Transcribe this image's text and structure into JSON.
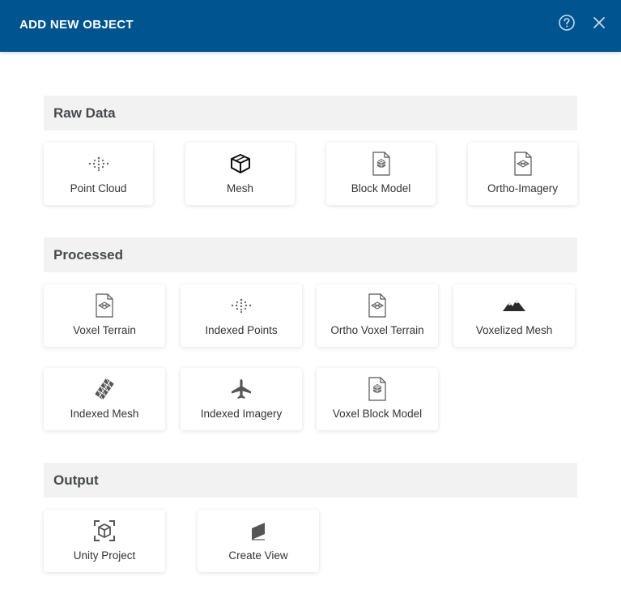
{
  "dialog": {
    "title": "ADD NEW OBJECT",
    "help_icon": "help-circle-icon",
    "close_icon": "close-icon",
    "header_color": "#005590"
  },
  "sections": {
    "raw_data": {
      "title": "Raw Data",
      "items": [
        {
          "label": "Point Cloud",
          "icon": "point-cloud-icon"
        },
        {
          "label": "Mesh",
          "icon": "mesh-box-icon"
        },
        {
          "label": "Block Model",
          "icon": "block-model-file-icon"
        },
        {
          "label": "Ortho-Imagery",
          "icon": "ortho-imagery-file-icon"
        }
      ]
    },
    "processed": {
      "title": "Processed",
      "items": [
        {
          "label": "Voxel Terrain",
          "icon": "voxel-terrain-file-icon"
        },
        {
          "label": "Indexed Points",
          "icon": "indexed-points-icon"
        },
        {
          "label": "Ortho Voxel Terrain",
          "icon": "ortho-voxel-terrain-file-icon"
        },
        {
          "label": "Voxelized Mesh",
          "icon": "mountains-icon"
        },
        {
          "label": "Indexed Mesh",
          "icon": "indexed-mesh-icon"
        },
        {
          "label": "Indexed Imagery",
          "icon": "airplane-icon"
        },
        {
          "label": "Voxel Block Model",
          "icon": "voxel-block-model-file-icon"
        }
      ]
    },
    "output": {
      "title": "Output",
      "items": [
        {
          "label": "Unity Project",
          "icon": "unity-cube-icon"
        },
        {
          "label": "Create View",
          "icon": "create-view-icon"
        }
      ]
    }
  }
}
